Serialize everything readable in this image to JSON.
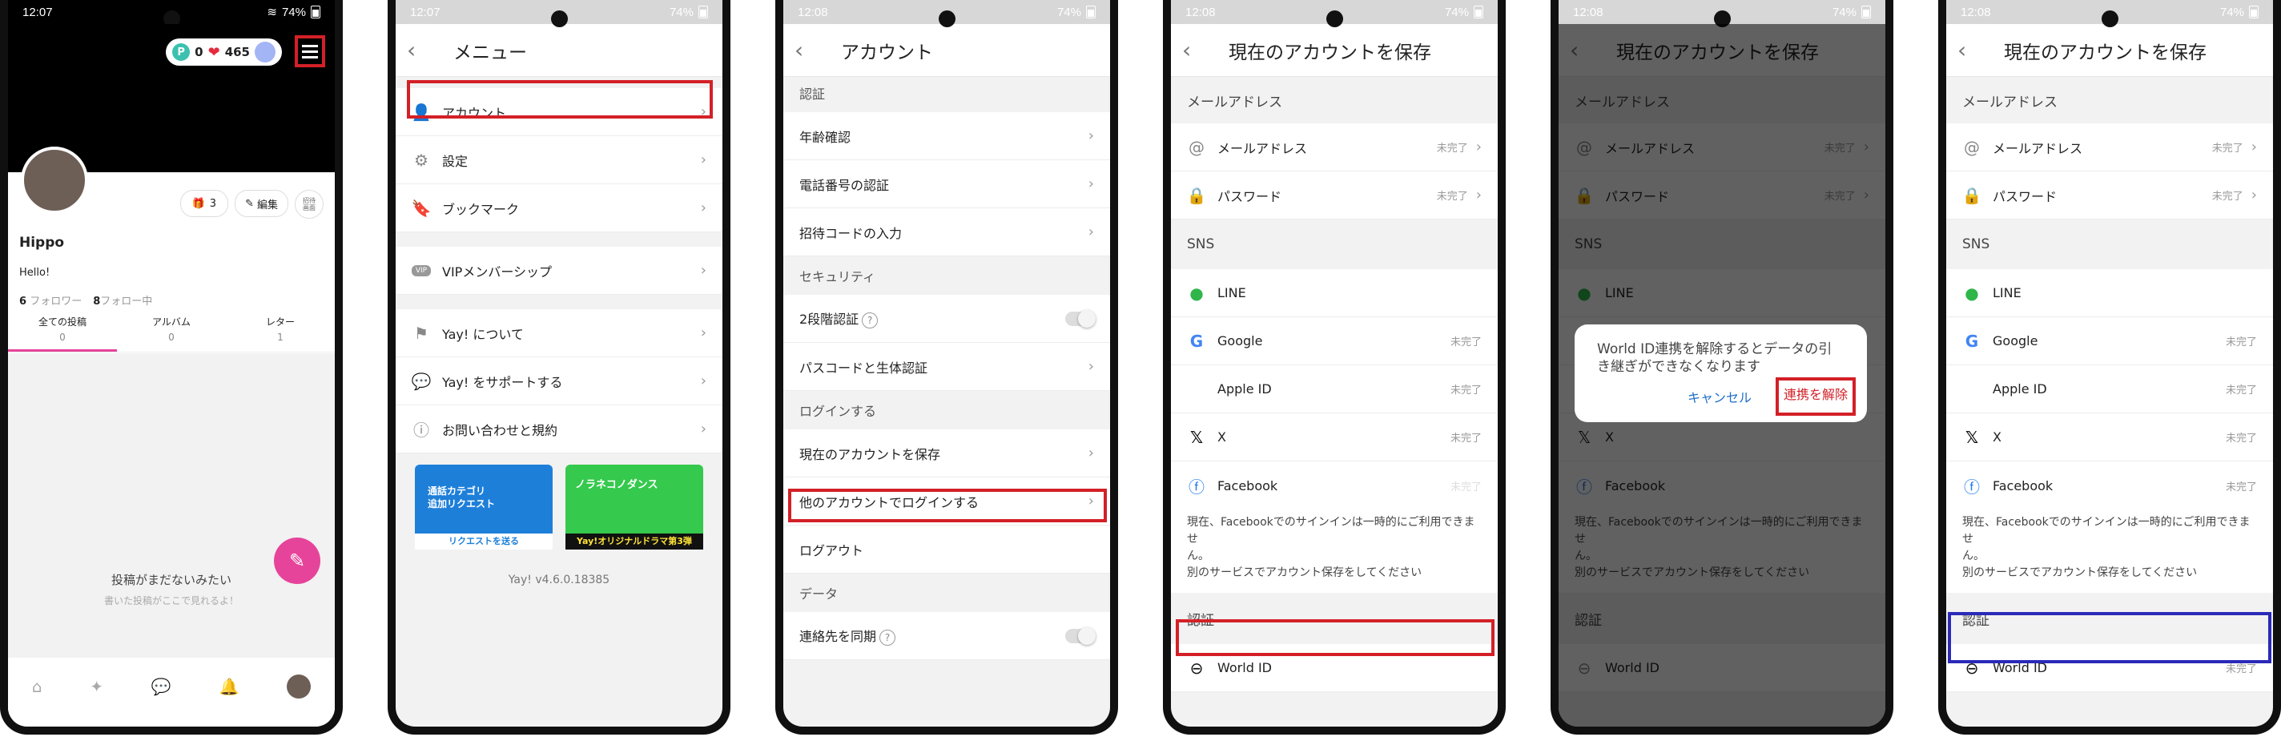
{
  "status_bar": {
    "phone1_time": "12:07",
    "phone2_time": "12:07",
    "phone3_time": "12:08",
    "phone4_time": "12:08",
    "phone5_time": "12:08",
    "phone6_time": "12:08",
    "battery": "74%"
  },
  "profile": {
    "points": "0",
    "hearts": "465",
    "name": "Hippo",
    "bio": "Hello!",
    "followers_count": "6",
    "followers_label": "フォロワー",
    "following_count": "8",
    "following_label": "フォロー中",
    "badge_count": "3",
    "edit_label": "編集",
    "qr_label": "招待\n画面",
    "tabs": [
      {
        "label": "全ての投稿",
        "count": "0"
      },
      {
        "label": "アルバム",
        "count": "0"
      },
      {
        "label": "レター",
        "count": "1"
      }
    ],
    "empty_title": "投稿がまだないみたい",
    "empty_sub": "書いた投稿がここで見れるよ！"
  },
  "menu": {
    "title": "メニュー",
    "items": [
      {
        "label": "アカウント"
      },
      {
        "label": "設定"
      },
      {
        "label": "ブックマーク"
      },
      {
        "label": "VIPメンバーシップ"
      },
      {
        "label": "Yay! について"
      },
      {
        "label": "Yay! をサポートする"
      },
      {
        "label": "お問い合わせと規約"
      }
    ],
    "vip_badge": "VIP",
    "banner1_line1": "通話カテゴリ",
    "banner1_line2": "追加リクエスト",
    "banner1_cta": "リクエストを送る",
    "banner2_title": "ノラネコノダンス",
    "banner2_cta": "Yay!オリジナルドラマ第3弾",
    "version": "Yay! v4.6.0.18385"
  },
  "account": {
    "title": "アカウント",
    "sections": [
      {
        "header": "認証",
        "rows": [
          "年齢確認",
          "電話番号の認証",
          "招待コードの入力"
        ]
      },
      {
        "header": "セキュリティ",
        "rows": [
          "2段階認証",
          "パスコードと生体認証"
        ]
      },
      {
        "header": "ログインする",
        "rows": [
          "現在のアカウントを保存",
          "他のアカウントでログインする",
          "ログアウト"
        ]
      },
      {
        "header": "データ",
        "rows": [
          "連絡先を同期"
        ]
      }
    ]
  },
  "save_account": {
    "title": "現在のアカウントを保存",
    "email_section": "メールアドレス",
    "email_label": "メールアドレス",
    "password_label": "パスワード",
    "sns_section": "SNS",
    "line": "LINE",
    "google": "Google",
    "apple": "Apple ID",
    "x": "X",
    "facebook": "Facebook",
    "facebook_note1": "現在、Facebookでのサインインは一時的にご利用できませ",
    "facebook_note2": "ん。",
    "facebook_note3": "別のサービスでアカウント保存をしてください",
    "auth_section": "認証",
    "world_id": "World ID",
    "incomplete": "未完了"
  },
  "dialog": {
    "message": "World ID連携を解除するとデータの引き継ぎができなくなります",
    "cancel": "キャンセル",
    "unlink": "連携を解除"
  },
  "colors": {
    "highlight_red": "#d32027",
    "highlight_blue": "#2a2ab8",
    "accent_pink": "#e6449a",
    "link_blue": "#1f6fc8"
  }
}
